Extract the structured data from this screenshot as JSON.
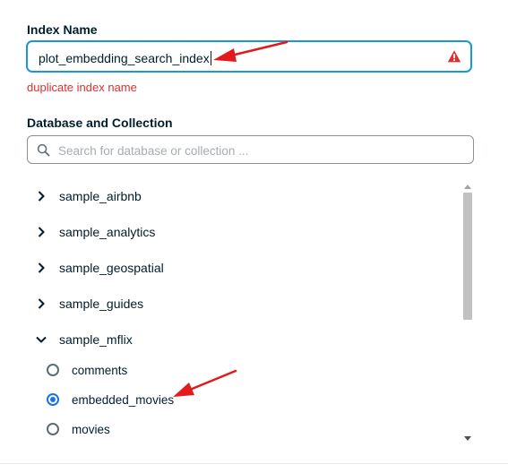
{
  "index_name": {
    "label": "Index Name",
    "value": "plot_embedding_search_index",
    "error": "duplicate index name"
  },
  "database_collection": {
    "label": "Database and Collection",
    "search_placeholder": "Search for database or collection ...",
    "databases": [
      {
        "name": "sample_airbnb",
        "expanded": false
      },
      {
        "name": "sample_analytics",
        "expanded": false
      },
      {
        "name": "sample_geospatial",
        "expanded": false
      },
      {
        "name": "sample_guides",
        "expanded": false
      },
      {
        "name": "sample_mflix",
        "expanded": true
      }
    ],
    "collections": [
      {
        "name": "comments",
        "selected": false
      },
      {
        "name": "embedded_movies",
        "selected": true
      },
      {
        "name": "movies",
        "selected": false
      }
    ]
  },
  "colors": {
    "focus_border": "#1a97d4",
    "error": "#db3030",
    "radio_selected": "#1a73e8",
    "annotation_arrow": "#e3191c"
  }
}
